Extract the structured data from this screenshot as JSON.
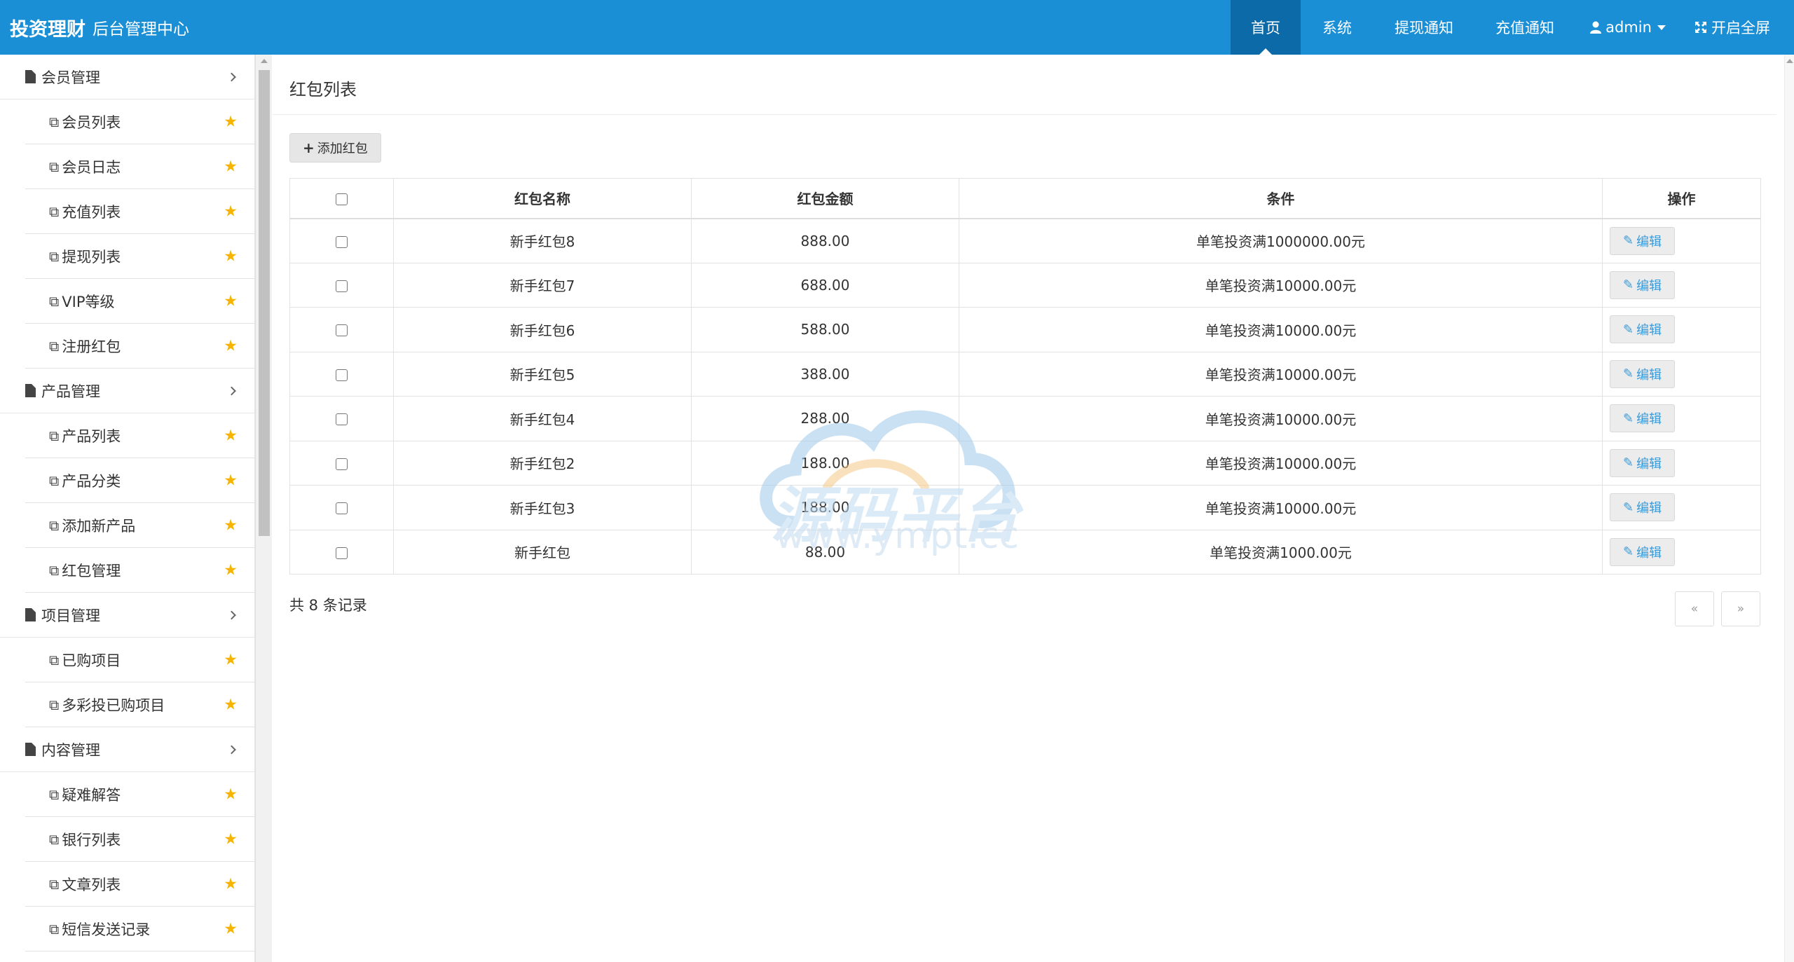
{
  "header": {
    "brand": "投资理财",
    "subtitle": "后台管理中心",
    "nav": [
      {
        "label": "首页",
        "active": true
      },
      {
        "label": "系统",
        "active": false
      },
      {
        "label": "提现通知",
        "active": false
      },
      {
        "label": "充值通知",
        "active": false
      }
    ],
    "user": "admin",
    "fullscreen": "开启全屏"
  },
  "sidebar": {
    "groups": [
      {
        "title": "会员管理",
        "items": [
          "会员列表",
          "会员日志",
          "充值列表",
          "提现列表",
          "VIP等级",
          "注册红包"
        ]
      },
      {
        "title": "产品管理",
        "items": [
          "产品列表",
          "产品分类",
          "添加新产品",
          "红包管理"
        ]
      },
      {
        "title": "项目管理",
        "items": [
          "已购项目",
          "多彩投已购项目"
        ]
      },
      {
        "title": "内容管理",
        "items": [
          "疑难解答",
          "银行列表",
          "文章列表",
          "短信发送记录"
        ]
      }
    ]
  },
  "main": {
    "title": "红包列表",
    "add_button": "添加红包",
    "columns": [
      "红包名称",
      "红包金额",
      "条件",
      "操作"
    ],
    "rows": [
      {
        "name": "新手红包8",
        "amount": "888.00",
        "condition": "单笔投资满1000000.00元",
        "action": "编辑"
      },
      {
        "name": "新手红包7",
        "amount": "688.00",
        "condition": "单笔投资满10000.00元",
        "action": "编辑"
      },
      {
        "name": "新手红包6",
        "amount": "588.00",
        "condition": "单笔投资满10000.00元",
        "action": "编辑"
      },
      {
        "name": "新手红包5",
        "amount": "388.00",
        "condition": "单笔投资满10000.00元",
        "action": "编辑"
      },
      {
        "name": "新手红包4",
        "amount": "288.00",
        "condition": "单笔投资满10000.00元",
        "action": "编辑"
      },
      {
        "name": "新手红包2",
        "amount": "188.00",
        "condition": "单笔投资满10000.00元",
        "action": "编辑"
      },
      {
        "name": "新手红包3",
        "amount": "188.00",
        "condition": "单笔投资满10000.00元",
        "action": "编辑"
      },
      {
        "name": "新手红包",
        "amount": "88.00",
        "condition": "单笔投资满1000.00元",
        "action": "编辑"
      }
    ],
    "total_text": "共 8 条记录",
    "pager": {
      "prev": "«",
      "next": "»"
    }
  },
  "watermark": {
    "line1": "源码平台",
    "line2": "www.ympt.cc"
  },
  "icons": {
    "doc": "file-icon",
    "puzzle": "puzzle-icon",
    "star": "star-icon",
    "user": "user-icon",
    "expand": "expand-icon",
    "edit": "edit-icon"
  },
  "colors": {
    "header": "#1b8fd6",
    "header_active": "#0d6aa8",
    "star": "#f5b400",
    "link": "#3a9ad9"
  }
}
